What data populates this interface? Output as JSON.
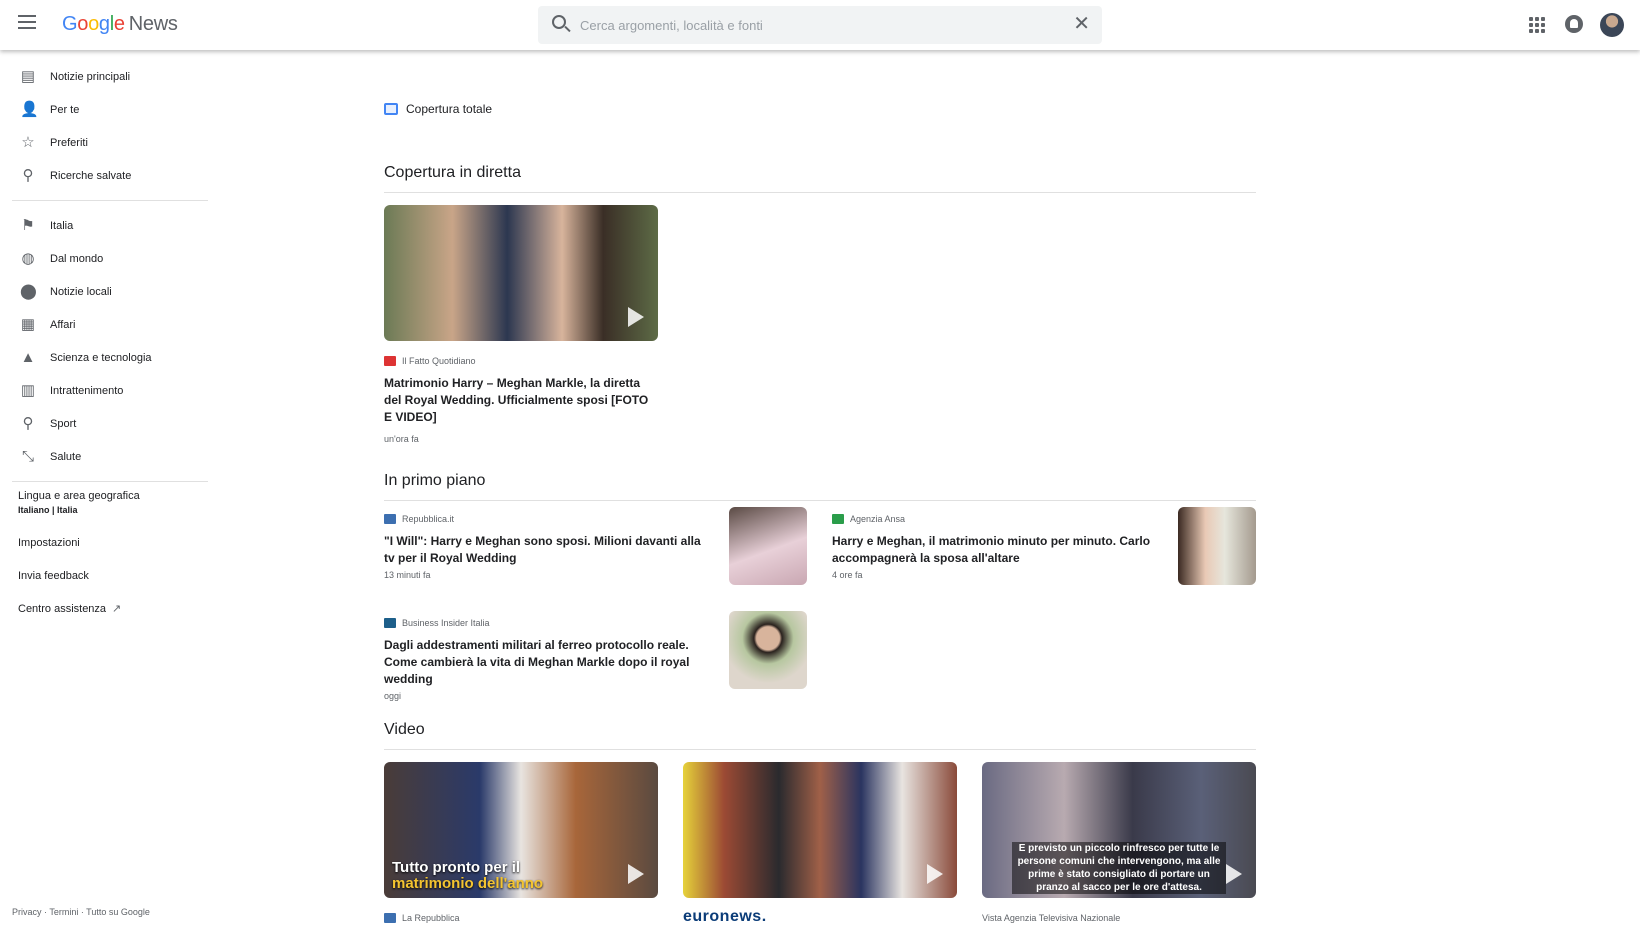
{
  "header": {
    "logo_google": "Google",
    "logo_news": "News",
    "search_placeholder": "Cerca argomenti, località e fonti"
  },
  "sidebar": {
    "primary": [
      {
        "label": "Notizie principali",
        "icon": "newspaper-icon"
      },
      {
        "label": "Per te",
        "icon": "person-icon"
      },
      {
        "label": "Preferiti",
        "icon": "star-icon"
      },
      {
        "label": "Ricerche salvate",
        "icon": "search-icon"
      }
    ],
    "topics": [
      {
        "label": "Italia",
        "icon": "flag-icon"
      },
      {
        "label": "Dal mondo",
        "icon": "globe-icon"
      },
      {
        "label": "Notizie locali",
        "icon": "pin-icon"
      },
      {
        "label": "Affari",
        "icon": "building-icon"
      },
      {
        "label": "Scienza e tecnologia",
        "icon": "flask-icon"
      },
      {
        "label": "Intrattenimento",
        "icon": "film-icon"
      },
      {
        "label": "Sport",
        "icon": "bike-icon"
      },
      {
        "label": "Salute",
        "icon": "health-icon"
      }
    ],
    "language_label": "Lingua e area geografica",
    "language_value": "Italiano | Italia",
    "settings": "Impostazioni",
    "feedback": "Invia feedback",
    "help": "Centro assistenza",
    "footer": "Privacy · Termini · Tutto su Google"
  },
  "main": {
    "full_coverage": "Copertura totale",
    "live": {
      "heading": "Copertura in diretta",
      "source": "Il Fatto Quotidiano",
      "title": "Matrimonio Harry – Meghan Markle, la diretta del Royal Wedding. Ufficialmente sposi [FOTO E VIDEO]",
      "time": "un'ora fa"
    },
    "top": {
      "heading": "In primo piano",
      "stories": [
        {
          "source": "Repubblica.it",
          "title": "\"I Will\": Harry e Meghan sono sposi. Milioni davanti alla tv per il Royal Wedding",
          "time": "13 minuti fa"
        },
        {
          "source": "Agenzia Ansa",
          "title": "Harry e Meghan, il matrimonio minuto per minuto. Carlo accompagnerà la sposa all'altare",
          "time": "4 ore fa"
        },
        {
          "source": "Business Insider Italia",
          "title": "Dagli addestramenti militari al ferreo protocollo reale. Come cambierà la vita di Meghan Markle dopo il royal wedding",
          "time": "oggi"
        }
      ]
    },
    "video": {
      "heading": "Video",
      "items": [
        {
          "caption_a": "Tutto pronto per il",
          "caption_b": "matrimonio dell'anno",
          "source": "La Repubblica"
        },
        {
          "source": "euronews."
        },
        {
          "caption": "E previsto un piccolo rinfresco per tutte le persone comuni che intervengono, ma alle prime è stato consigliato di portare un pranzo al sacco per le ore d'attesa.",
          "source": "Vista Agenzia Televisiva Nazionale"
        }
      ]
    }
  }
}
